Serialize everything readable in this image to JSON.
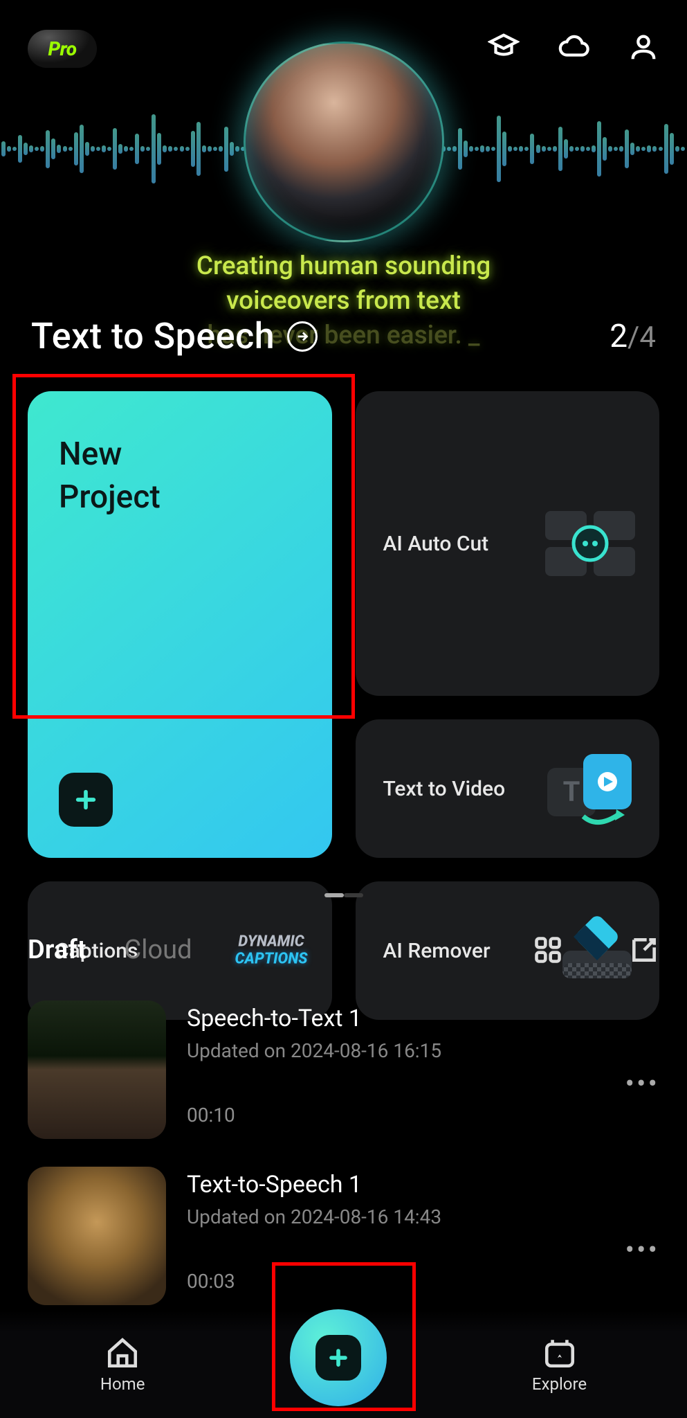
{
  "badge": {
    "label": "Pro"
  },
  "hero": {
    "line1": "Creating human sounding",
    "line2": "voiceovers from text",
    "line3_prefix": "has never been easier. _"
  },
  "feature_header": {
    "title": "Text to Speech",
    "page_current": "2",
    "page_total": "4"
  },
  "cards": {
    "new_project_line1": "New",
    "new_project_line2": "Project",
    "ai_auto_cut": "AI Auto Cut",
    "text_to_video": "Text to Video",
    "captions": "Captions",
    "captions_dynamic_l1": "DYNAMIC",
    "captions_dynamic_l2": "CAPTIONS",
    "ai_remover": "AI Remover"
  },
  "tabs": {
    "draft": "Draft",
    "cloud": "Cloud"
  },
  "drafts": [
    {
      "title": "Speech-to-Text 1",
      "subtitle": "Updated on 2024-08-16 16:15",
      "duration": "00:10"
    },
    {
      "title": "Text-to-Speech 1",
      "subtitle": "Updated on 2024-08-16 14:43",
      "duration": "00:03"
    }
  ],
  "nav": {
    "home": "Home",
    "explore": "Explore"
  }
}
